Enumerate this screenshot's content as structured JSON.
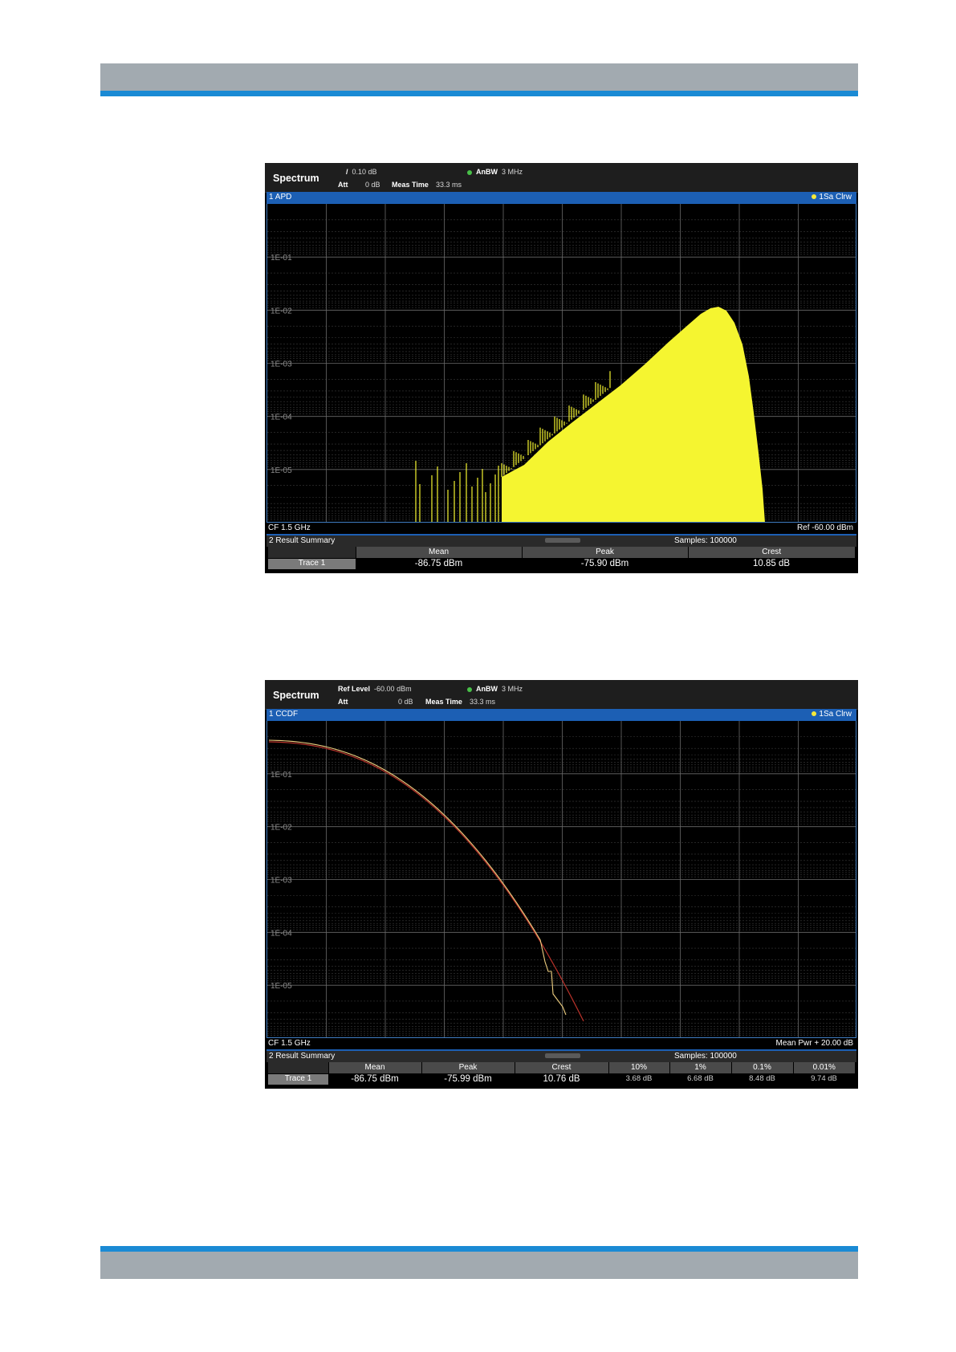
{
  "colors": {
    "band_gray": "#a2aab0",
    "band_blue": "#1a8ad4",
    "title_bar": "#1c5fb4",
    "trace_yellow": "#f5f530",
    "ref_curve": "#b8322a"
  },
  "screens": [
    {
      "header": {
        "app": "Spectrum",
        "line1_icon": "/",
        "line1_value": "0.10 dB",
        "att_label": "Att",
        "att_value": "0 dB",
        "meas_time_label": "Meas Time",
        "meas_time_value": "33.3 ms",
        "rbw_label": "AnBW",
        "rbw_value": "3 MHz"
      },
      "title": "1 APD",
      "trace_label": "1Sa Clrw",
      "ylabels": [
        "1E-01",
        "1E-02",
        "1E-03",
        "1E-04",
        "1E-05"
      ],
      "cf": "CF 1.5 GHz",
      "right_footer": "Ref -60.00 dBm",
      "summary_title": "2 Result Summary",
      "samples": "Samples: 100000",
      "table": {
        "row_label": "Trace 1",
        "headers": [
          "Mean",
          "Peak",
          "Crest"
        ],
        "values": [
          "-86.75 dBm",
          "-75.90 dBm",
          "10.85 dB"
        ]
      }
    },
    {
      "header": {
        "app": "Spectrum",
        "line1_icon": "Ref Level",
        "line1_value": "-60.00 dBm",
        "att_label": "Att",
        "att_value": "0 dB",
        "meas_time_label": "Meas Time",
        "meas_time_value": "33.3 ms",
        "rbw_label": "AnBW",
        "rbw_value": "3 MHz"
      },
      "title": "1 CCDF",
      "trace_label": "1Sa Clrw",
      "ylabels": [
        "1E-01",
        "1E-02",
        "1E-03",
        "1E-04",
        "1E-05"
      ],
      "cf": "CF 1.5 GHz",
      "right_footer": "Mean Pwr + 20.00 dB",
      "summary_title": "2 Result Summary",
      "samples": "Samples: 100000",
      "table": {
        "row_label": "Trace 1",
        "headers": [
          "Mean",
          "Peak",
          "Crest",
          "10%",
          "1%",
          "0.1%",
          "0.01%"
        ],
        "values": [
          "-86.75 dBm",
          "-75.99 dBm",
          "10.76 dB",
          "3.68 dB",
          "6.68 dB",
          "8.48 dB",
          "9.74 dB"
        ]
      }
    }
  ]
}
